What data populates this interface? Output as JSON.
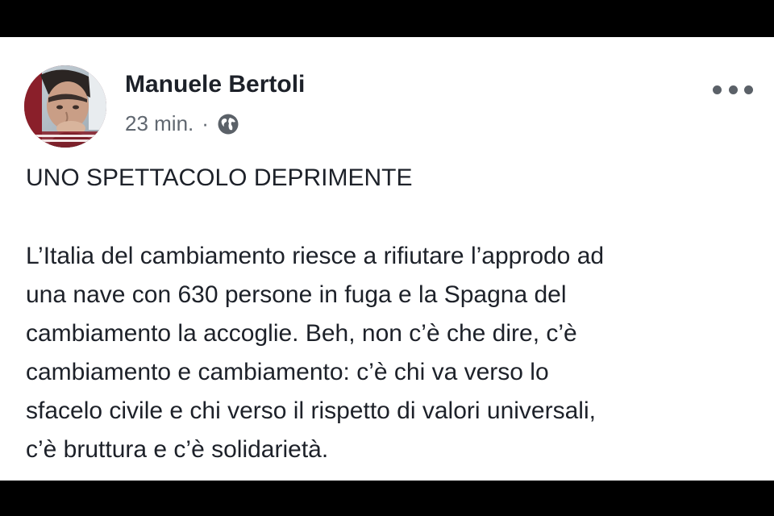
{
  "post": {
    "author": "Manuele Bertoli",
    "timestamp": "23 min.",
    "separator": "·",
    "privacy_icon": "globe-icon",
    "more_icon": "more-options-icon",
    "headline": "UNO SPETTACOLO DEPRIMENTE",
    "body_lines": [
      "L’Italia del cambiamento riesce a rifiutare l’approdo ad",
      "una nave con 630 persone in fuga e la Spagna del",
      "cambiamento la accoglie. Beh, non c’è che dire, c’è",
      "cambiamento e cambiamento: c’è chi va verso lo",
      "sfacelo civile e chi verso il rispetto di valori universali,",
      "c’è bruttura e c’è solidarietà."
    ]
  },
  "colors": {
    "text": "#1d2129",
    "meta": "#606770",
    "background": "#ffffff",
    "letterbox": "#000000"
  }
}
